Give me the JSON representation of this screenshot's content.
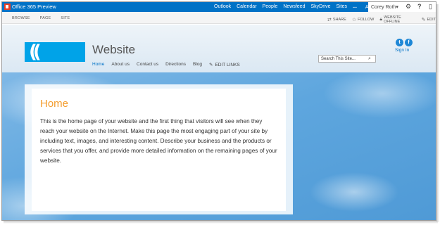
{
  "suitebar": {
    "brand": "Office 365 Preview",
    "links": [
      "Outlook",
      "Calendar",
      "People",
      "Newsfeed",
      "SkyDrive",
      "Sites",
      "..."
    ],
    "admin": "Admin",
    "user": "Corey Roth"
  },
  "ribbon": {
    "tabs": [
      "BROWSE",
      "PAGE",
      "SITE"
    ],
    "actions": {
      "share": "SHARE",
      "follow": "FOLLOW",
      "offline": "WEBSITE OFFLINE",
      "edit": "EDIT"
    }
  },
  "header": {
    "logo": "((",
    "title": "Website",
    "nav": [
      "Home",
      "About us",
      "Contact us",
      "Directions",
      "Blog"
    ],
    "edit_links": "EDIT LINKS",
    "search_placeholder": "Search This Site...",
    "sign_in": "Sign In",
    "social": [
      "t",
      "f"
    ]
  },
  "main": {
    "heading": "Home",
    "body": "This is the home page of your website and the first thing that visitors will see when they reach your website on the Internet. Make this page the most engaging part of your site by including text, images, and interesting content. Describe your business and the products or services that you offer, and provide more detailed information on the remaining pages of your website."
  },
  "colors": {
    "suitebar": "#0072c6",
    "logo": "#00a3e8",
    "heading": "#f39c2d",
    "link": "#0072c6"
  }
}
